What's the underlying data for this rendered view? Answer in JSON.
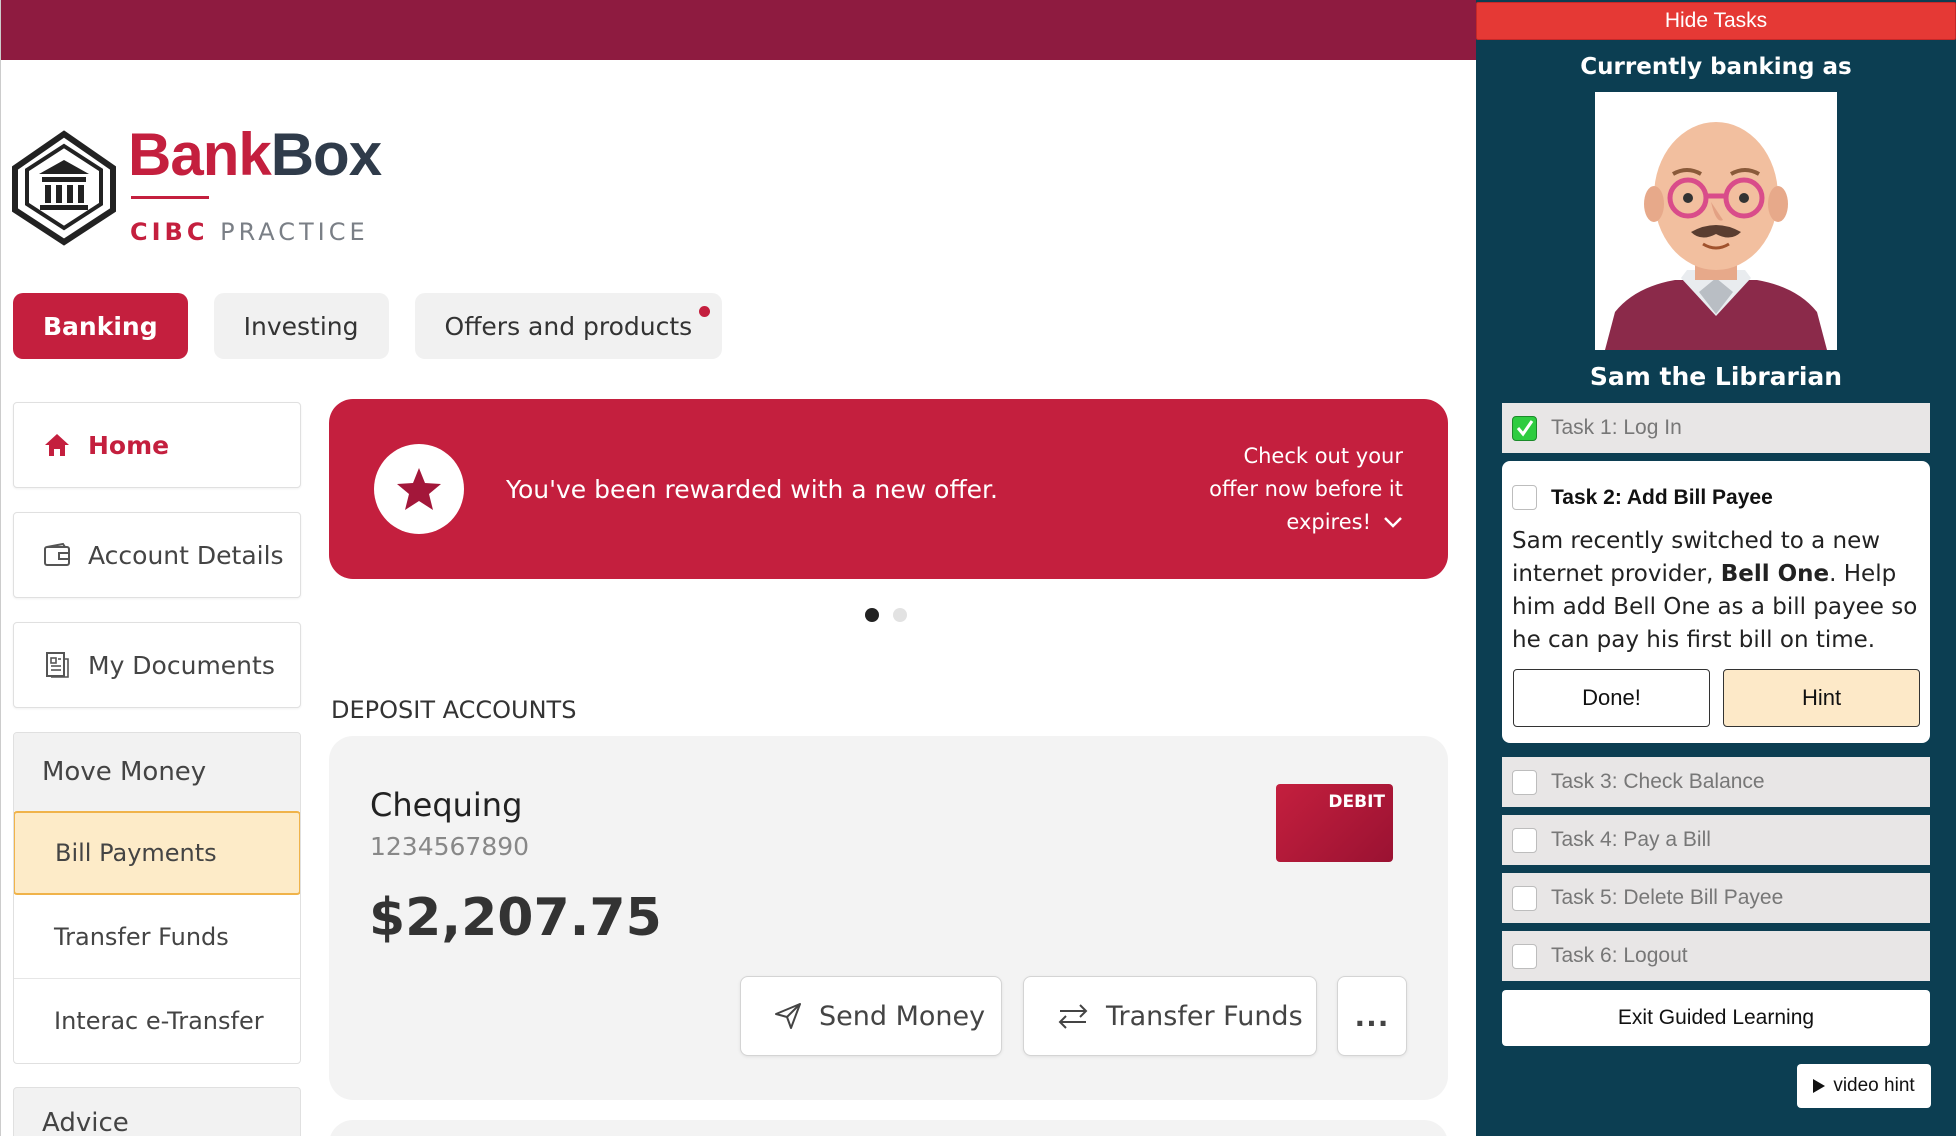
{
  "brand": {
    "name_part1": "Bank",
    "name_part2": "Box",
    "sub_cibc": "CIBC",
    "sub_practice": "PRACTICE"
  },
  "nav": {
    "tabs": [
      {
        "label": "Banking",
        "active": true
      },
      {
        "label": "Investing",
        "active": false
      },
      {
        "label": "Offers and products",
        "active": false,
        "has_notification": true
      }
    ]
  },
  "sidebar": {
    "home": "Home",
    "account_details": "Account Details",
    "my_documents": "My Documents",
    "move_money": {
      "heading": "Move Money",
      "items": [
        "Bill Payments",
        "Transfer Funds",
        "Interac e-Transfer"
      ],
      "selected": "Bill Payments"
    },
    "advice": "Advice"
  },
  "promo": {
    "message": "You've been rewarded with a new offer.",
    "cta_line1": "Check out your",
    "cta_line2": "offer now before it",
    "cta_line3": "expires!",
    "carousel_pages": 2,
    "carousel_active": 1
  },
  "deposit": {
    "section_title": "DEPOSIT ACCOUNTS",
    "account": {
      "name": "Chequing",
      "number": "1234567890",
      "balance": "$2,207.75",
      "card_label": "DEBIT",
      "actions": {
        "send": "Send Money",
        "transfer": "Transfer Funds",
        "more": "..."
      }
    }
  },
  "tasks_panel": {
    "hide_label": "Hide Tasks",
    "banking_as_label": "Currently banking as",
    "persona_name": "Sam the Librarian",
    "tasks": [
      {
        "label": "Task 1: Log In",
        "done": true
      },
      {
        "label": "Task 2: Add Bill Payee",
        "done": false,
        "expanded": true
      },
      {
        "label": "Task 3: Check Balance",
        "done": false
      },
      {
        "label": "Task 4: Pay a Bill",
        "done": false
      },
      {
        "label": "Task 5: Delete Bill Payee",
        "done": false
      },
      {
        "label": "Task 6: Logout",
        "done": false
      }
    ],
    "active_task": {
      "body_part1": "Sam recently switched to a new internet provider, ",
      "body_bold": "Bell One",
      "body_part2": ". Help him add Bell One as a bill payee so he can pay his first bill on time.",
      "done_label": "Done!",
      "hint_label": "Hint"
    },
    "exit_label": "Exit Guided Learning",
    "video_hint_label": "video hint"
  },
  "colors": {
    "brand_red": "#c41f3e",
    "topbar": "#8e1b40",
    "panel_bg": "#0c3e52",
    "hide_button": "#e53935",
    "selected_item_bg": "#fdebc8",
    "selected_item_border": "#f0b34a",
    "hint_bg": "#fde9c8"
  }
}
